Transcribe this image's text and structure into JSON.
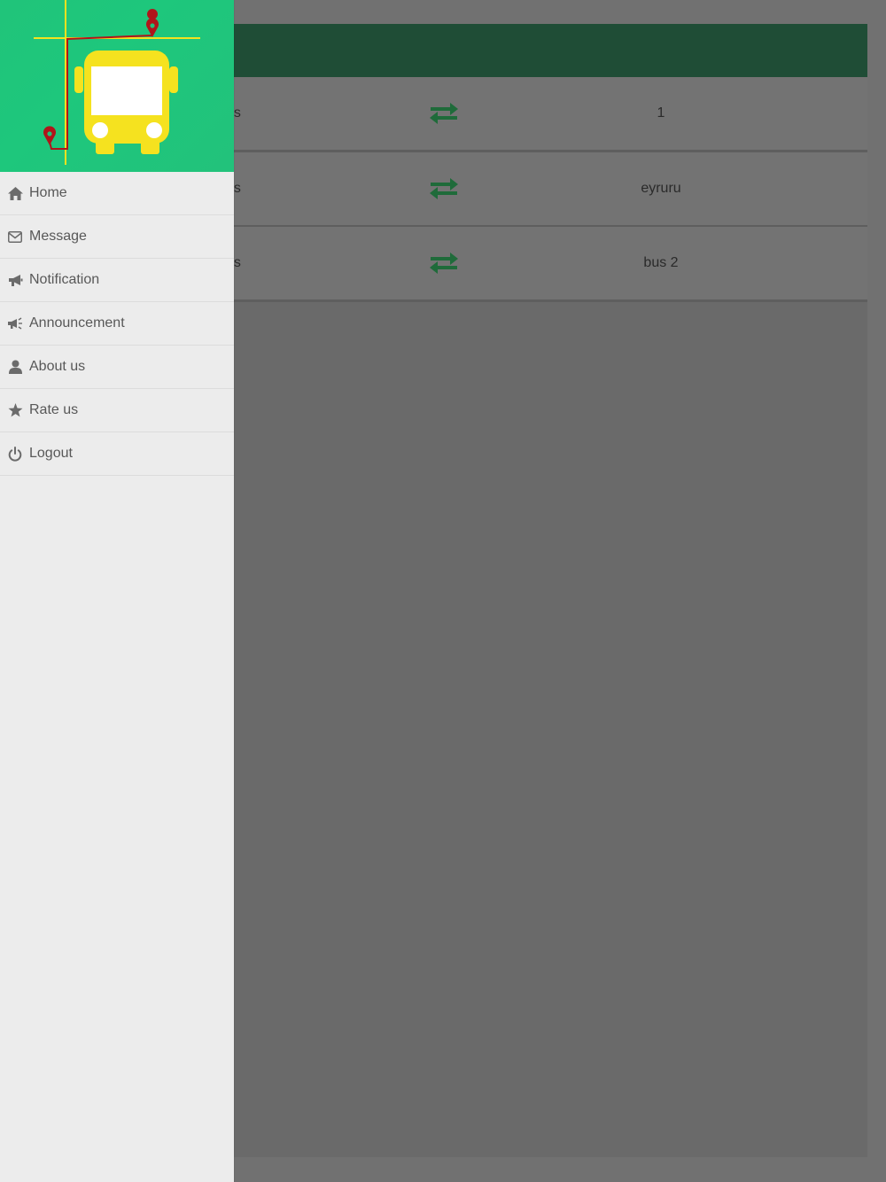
{
  "drawer": {
    "items": [
      {
        "label": "Home",
        "icon": "home-icon"
      },
      {
        "label": "Message",
        "icon": "envelope-icon"
      },
      {
        "label": "Notification",
        "icon": "bullhorn-icon"
      },
      {
        "label": "Announcement",
        "icon": "megaphone-icon"
      },
      {
        "label": "About us",
        "icon": "user-icon"
      },
      {
        "label": "Rate us",
        "icon": "star-icon"
      },
      {
        "label": "Logout",
        "icon": "power-icon"
      }
    ]
  },
  "main": {
    "rows": [
      {
        "label": "us",
        "name": "1"
      },
      {
        "label": "us",
        "name": "eyruru"
      },
      {
        "label": "us",
        "name": "bus 2"
      }
    ]
  },
  "colors": {
    "header": "#1f4d36",
    "banner": "#20c47a",
    "accent_swap": "#1f6b3a",
    "bus_yellow": "#f5e21f",
    "pin_red": "#b0151a"
  }
}
